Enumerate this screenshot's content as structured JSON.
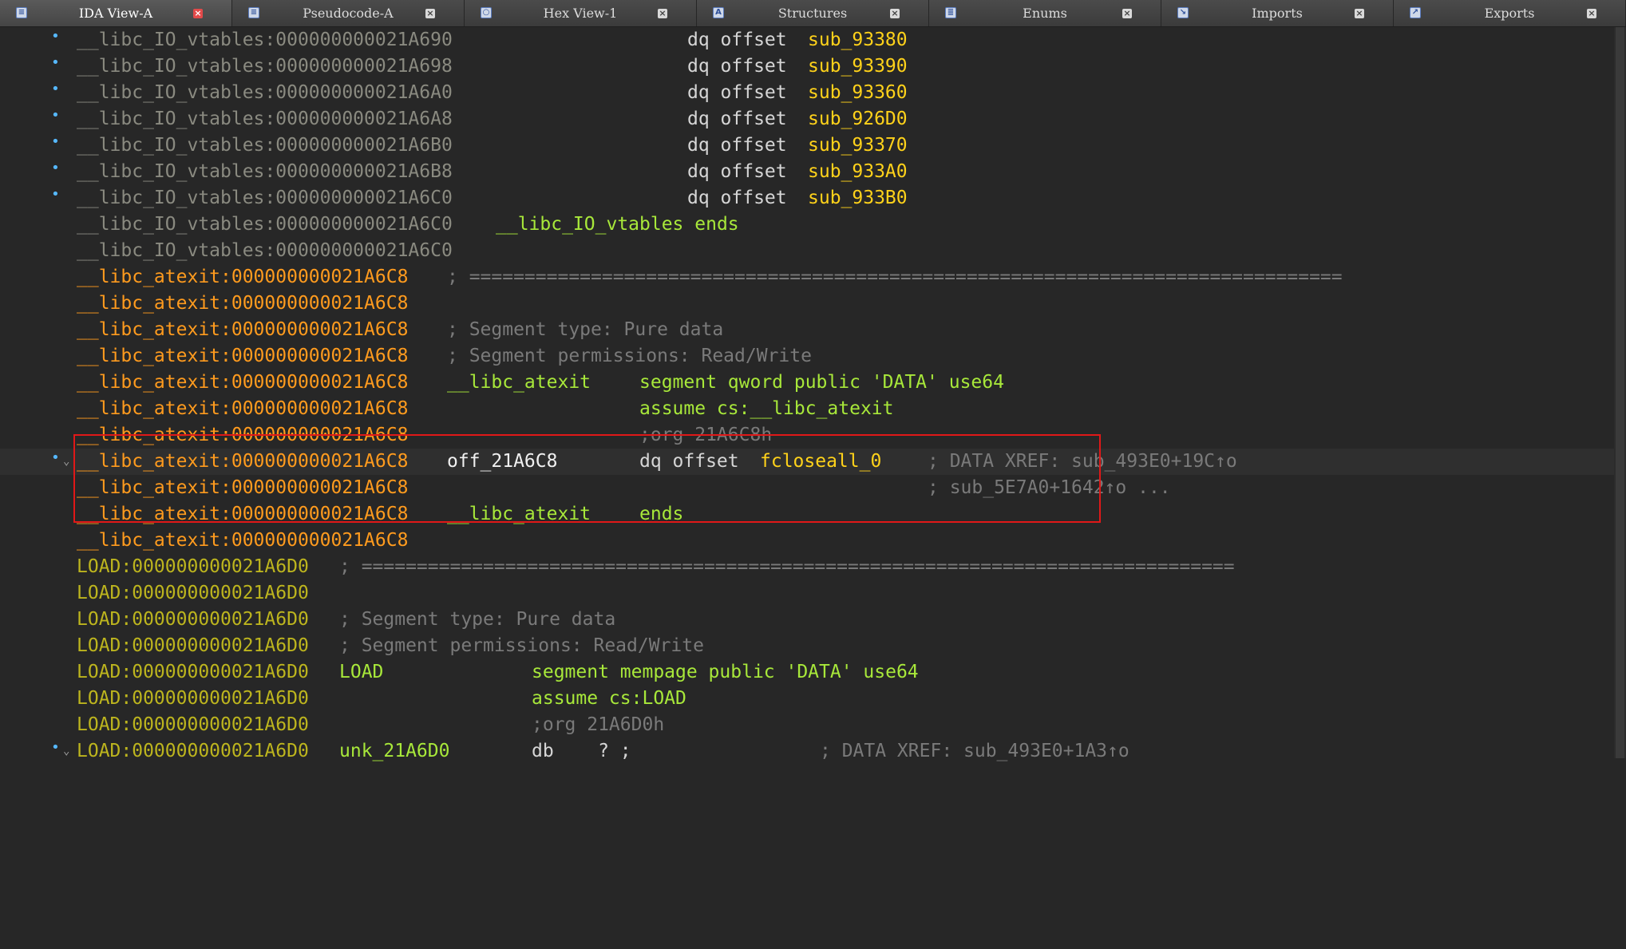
{
  "tabs": [
    {
      "label": "IDA View-A",
      "icon": "ida-view-icon",
      "active": true
    },
    {
      "label": "Pseudocode-A",
      "icon": "pseudocode-icon",
      "active": false
    },
    {
      "label": "Hex View-1",
      "icon": "hex-view-icon",
      "active": false
    },
    {
      "label": "Structures",
      "icon": "structures-icon",
      "active": false
    },
    {
      "label": "Enums",
      "icon": "enums-icon",
      "active": false
    },
    {
      "label": "Imports",
      "icon": "imports-icon",
      "active": false
    },
    {
      "label": "Exports",
      "icon": "exports-icon",
      "active": false
    }
  ],
  "colors": {
    "background": "#272727",
    "address_io_vtables": "#8a8a80",
    "address_libc_atexit": "#ff9b1e",
    "address_load": "#bdb51e",
    "reference": "#ffd21a",
    "directive": "#a8e83a",
    "comment": "#7a7a7a",
    "highlight_box": "#e01818"
  },
  "lines": [
    {
      "addr": "__libc_IO_vtables:000000000021A690",
      "instr": "dq offset ",
      "ref": "sub_93380"
    },
    {
      "addr": "__libc_IO_vtables:000000000021A698",
      "instr": "dq offset ",
      "ref": "sub_93390"
    },
    {
      "addr": "__libc_IO_vtables:000000000021A6A0",
      "instr": "dq offset ",
      "ref": "sub_93360"
    },
    {
      "addr": "__libc_IO_vtables:000000000021A6A8",
      "instr": "dq offset ",
      "ref": "sub_926D0"
    },
    {
      "addr": "__libc_IO_vtables:000000000021A6B0",
      "instr": "dq offset ",
      "ref": "sub_93370"
    },
    {
      "addr": "__libc_IO_vtables:000000000021A6B8",
      "instr": "dq offset ",
      "ref": "sub_933A0"
    },
    {
      "addr": "__libc_IO_vtables:000000000021A6C0",
      "instr": "dq offset ",
      "ref": "sub_933B0"
    },
    {
      "addr": "__libc_IO_vtables:000000000021A6C0",
      "name": "__libc_IO_vtables ends"
    },
    {
      "addr": "__libc_IO_vtables:000000000021A6C0"
    },
    {
      "addr": "__libc_atexit:000000000021A6C8",
      "comment": "; ==============================================================================="
    },
    {
      "addr": "__libc_atexit:000000000021A6C8"
    },
    {
      "addr": "__libc_atexit:000000000021A6C8",
      "comment": "; Segment type: Pure data"
    },
    {
      "addr": "__libc_atexit:000000000021A6C8",
      "comment": "; Segment permissions: Read/Write"
    },
    {
      "addr": "__libc_atexit:000000000021A6C8",
      "label": "__libc_atexit",
      "directive": "segment qword public 'DATA' use64"
    },
    {
      "addr": "__libc_atexit:000000000021A6C8",
      "directive": "assume cs:__libc_atexit"
    },
    {
      "addr": "__libc_atexit:000000000021A6C8",
      "comment": ";org 21A6C8h"
    },
    {
      "addr": "__libc_atexit:000000000021A6C8",
      "label": "off_21A6C8",
      "instr": "dq offset ",
      "ref": "fcloseall_0",
      "xref": "; DATA XREF: sub_493E0+19C↑o"
    },
    {
      "addr": "__libc_atexit:000000000021A6C8",
      "xref": "; sub_5E7A0+1642↑o ..."
    },
    {
      "addr": "__libc_atexit:000000000021A6C8",
      "label": "__libc_atexit",
      "directive": "ends"
    },
    {
      "addr": "__libc_atexit:000000000021A6C8"
    },
    {
      "addr": "LOAD:000000000021A6D0",
      "comment": "; ==============================================================================="
    },
    {
      "addr": "LOAD:000000000021A6D0"
    },
    {
      "addr": "LOAD:000000000021A6D0",
      "comment": "; Segment type: Pure data"
    },
    {
      "addr": "LOAD:000000000021A6D0",
      "comment": "; Segment permissions: Read/Write"
    },
    {
      "addr": "LOAD:000000000021A6D0",
      "label": "LOAD",
      "directive": "segment mempage public 'DATA' use64"
    },
    {
      "addr": "LOAD:000000000021A6D0",
      "directive": "assume cs:LOAD"
    },
    {
      "addr": "LOAD:000000000021A6D0",
      "comment": ";org 21A6D0h"
    },
    {
      "addr": "LOAD:000000000021A6D0",
      "label": "unk_21A6D0",
      "instr": "db    ? ;",
      "xref": "; DATA XREF: sub_493E0+1A3↑o"
    }
  ]
}
